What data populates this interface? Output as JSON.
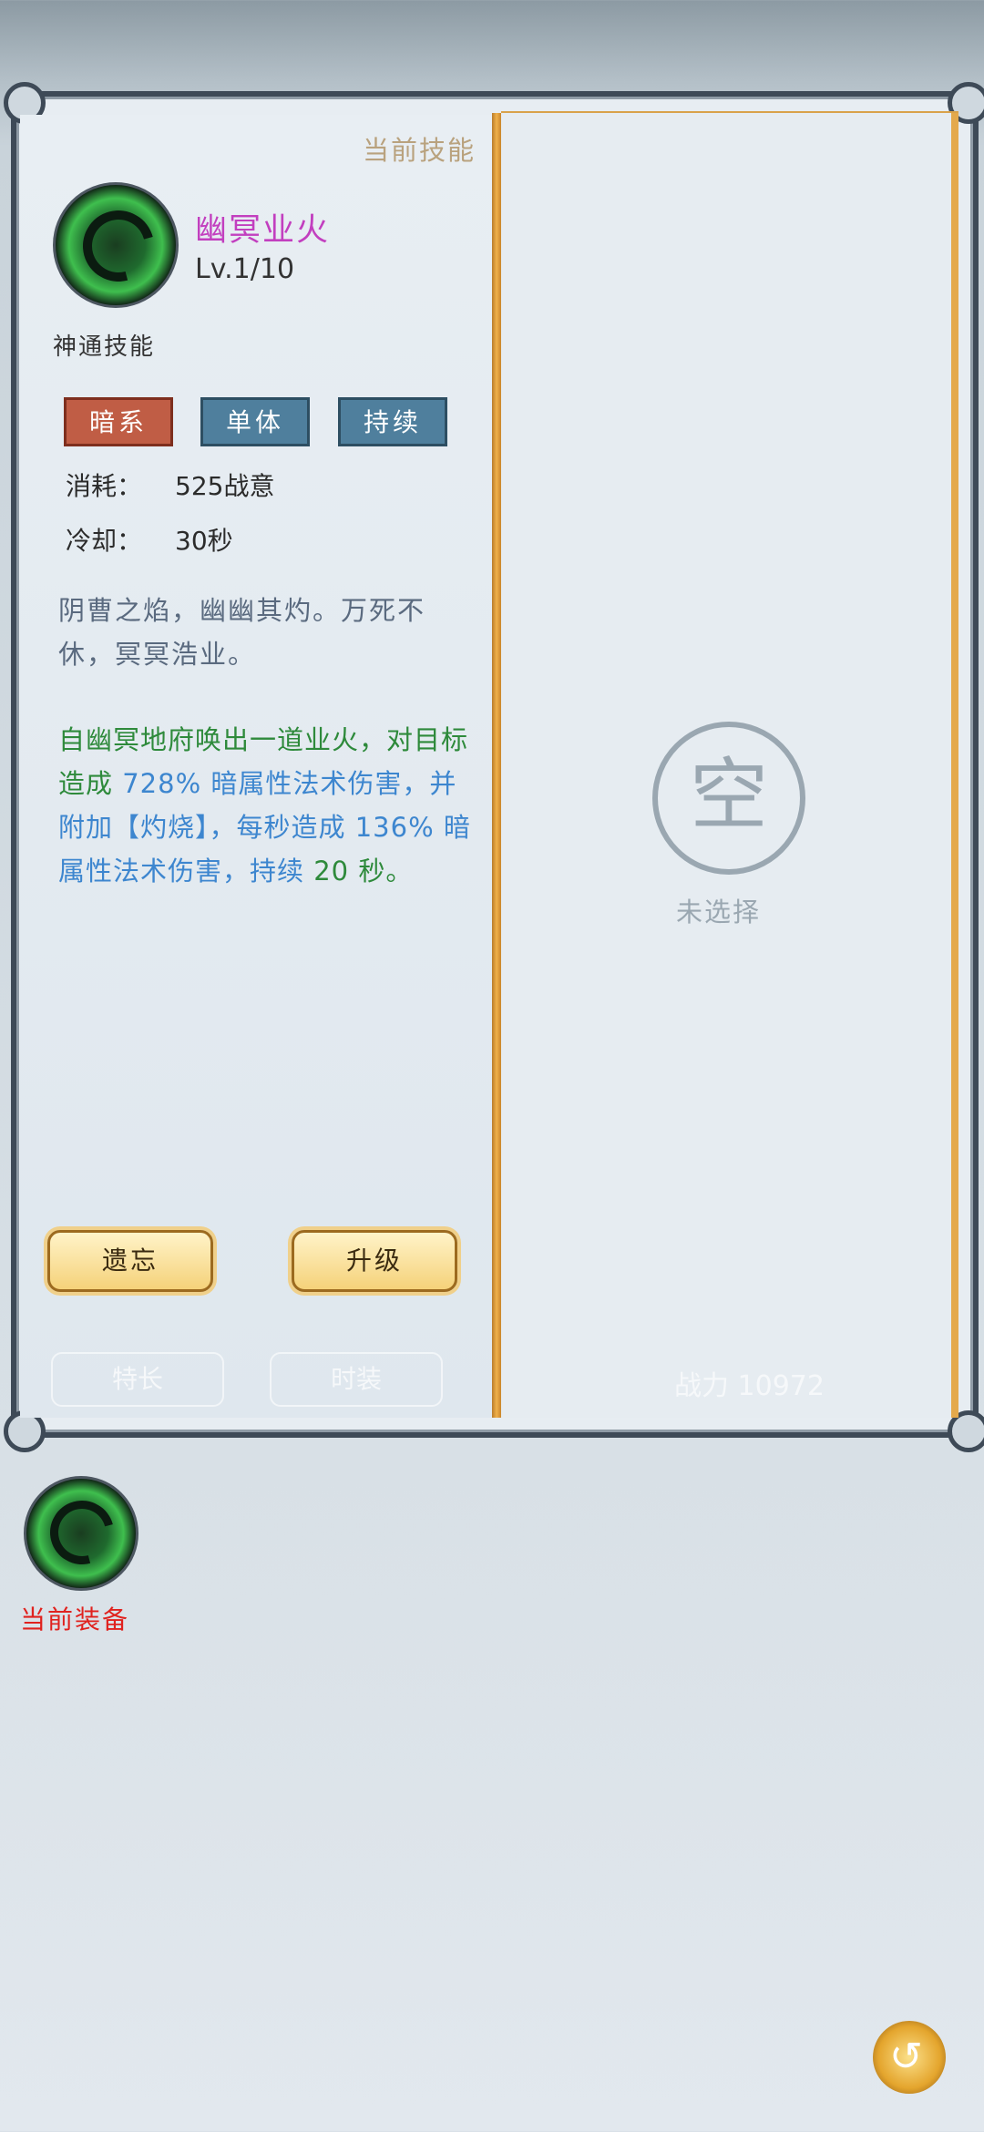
{
  "header": {
    "current_skill_label": "当前技能"
  },
  "skill": {
    "name": "幽冥业火",
    "level": "Lv.1/10",
    "type": "神通技能",
    "tags": [
      "暗系",
      "单体",
      "持续"
    ],
    "consume_label": "消耗：",
    "consume_value": "525战意",
    "cooldown_label": "冷却：",
    "cooldown_value": "30秒",
    "lore": "阴曹之焰，幽幽其灼。万死不休，冥冥浩业。",
    "desc": {
      "p1": "自幽冥地府唤出一道业火，对目标造成",
      "pct1": "728%",
      "p2": "暗属性法术伤害，并附加【灼烧】，每秒造成",
      "pct2": "136%",
      "p3": "暗属性法术伤害，持续",
      "dur": "20",
      "p4": "秒。"
    }
  },
  "buttons": {
    "forget": "遗忘",
    "upgrade": "升级"
  },
  "background": {
    "tab1": "特长",
    "tab2": "时装",
    "power": "战力 10972"
  },
  "right_panel": {
    "empty_label": "未选择",
    "empty_glyph": "空"
  },
  "equipment": {
    "label": "当前装备"
  },
  "colors": {
    "name": "#c23fbf",
    "desc": "#2e8a3b",
    "highlight": "#3d86cf",
    "equip_label": "#e0221e"
  }
}
